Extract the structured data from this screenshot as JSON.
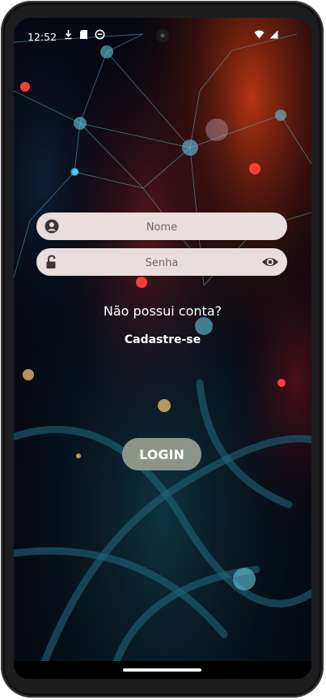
{
  "status_bar": {
    "time": "12:52",
    "left_icons": [
      "download-icon",
      "sd-card-icon",
      "app-notification-icon"
    ],
    "right_icons": [
      "wifi-icon",
      "signal-icon"
    ]
  },
  "login_form": {
    "name_field": {
      "placeholder": "Nome",
      "value": "",
      "icon": "user-icon"
    },
    "password_field": {
      "placeholder": "Senha",
      "value": "",
      "icon": "unlock-icon",
      "toggle_icon": "eye-icon"
    },
    "no_account_text": "Não possui conta?",
    "signup_link": "Cadastre-se",
    "login_button": "LOGIN"
  },
  "colors": {
    "input_background": "#e9dedd",
    "login_button_background": "#8a9688",
    "text": "#ffffff"
  }
}
